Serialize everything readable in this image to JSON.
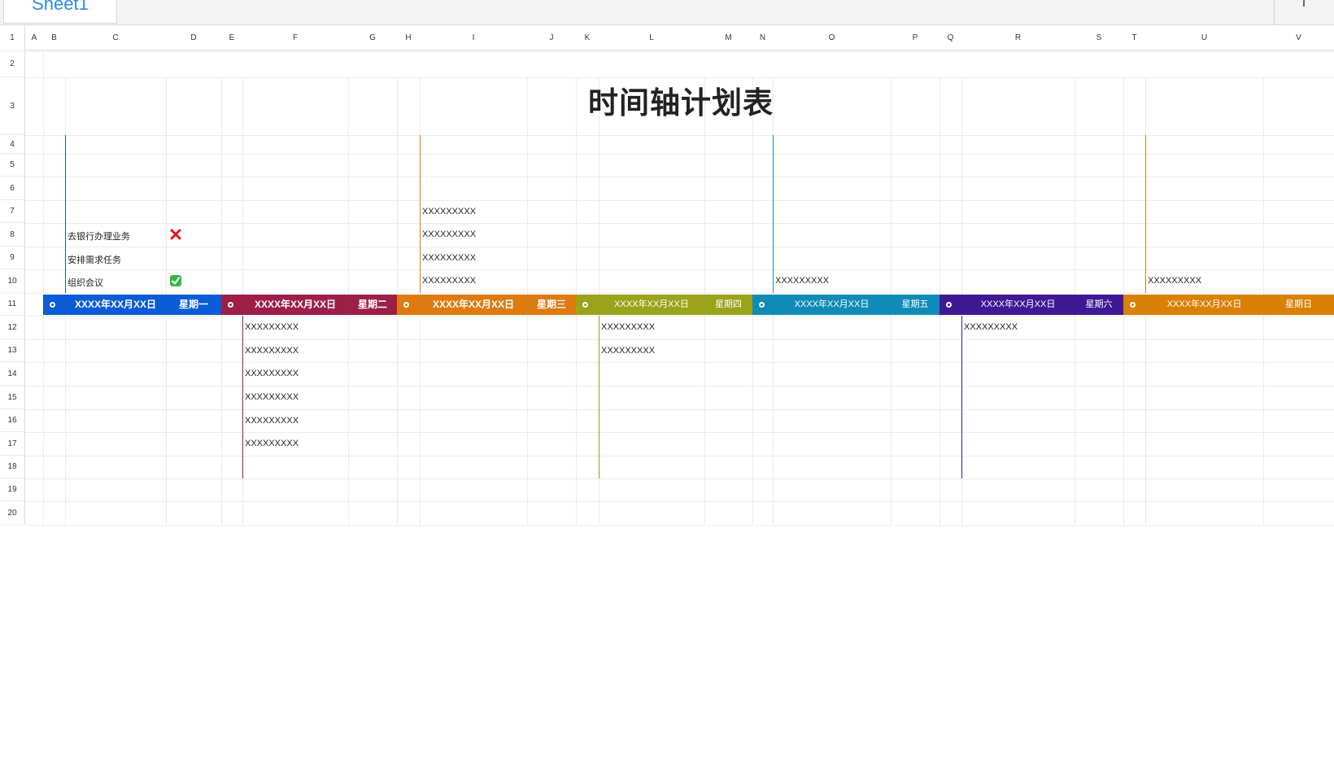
{
  "tab": {
    "sheet_name": "Sheet1"
  },
  "columns": [
    "A",
    "B",
    "C",
    "D",
    "E",
    "F",
    "G",
    "H",
    "I",
    "J",
    "K",
    "L",
    "M",
    "N",
    "O",
    "P",
    "Q",
    "R",
    "S",
    "T",
    "U",
    "V"
  ],
  "rows": [
    "1",
    "2",
    "3",
    "4",
    "5",
    "6",
    "7",
    "8",
    "9",
    "10",
    "11",
    "12",
    "13",
    "14",
    "15",
    "16",
    "17",
    "18",
    "19",
    "20"
  ],
  "title": "时间轴计划表",
  "tasks": [
    {
      "label": "去银行办理业务",
      "status": "x-icon"
    },
    {
      "label": "安排需求任务",
      "status": ""
    },
    {
      "label": "组织会议",
      "status": "check-icon"
    }
  ],
  "days": [
    {
      "date": "XXXX年XX月XX日",
      "weekday": "星期一",
      "color": "#0a5bd6",
      "items_above": [],
      "items_below": []
    },
    {
      "date": "XXXX年XX月XX日",
      "weekday": "星期二",
      "color": "#9c1f47",
      "items_above": [],
      "items_below": [
        "XXXXXXXXX",
        "XXXXXXXXX",
        "XXXXXXXXX",
        "XXXXXXXXX",
        "XXXXXXXXX",
        "XXXXXXXXX"
      ]
    },
    {
      "date": "XXXX年XX月XX日",
      "weekday": "星期三",
      "color": "#dd7a10",
      "items_above": [
        "XXXXXXXXX",
        "XXXXXXXXX",
        "XXXXXXXXX",
        "XXXXXXXXX"
      ],
      "items_below": []
    },
    {
      "date": "XXXX年XX月XX日",
      "weekday": "星期四",
      "color": "#9aa31a",
      "items_above": [],
      "items_below": [
        "XXXXXXXXX",
        "XXXXXXXXX"
      ]
    },
    {
      "date": "XXXX年XX月XX日",
      "weekday": "星期五",
      "color": "#108bb8",
      "items_above": [
        "XXXXXXXXX"
      ],
      "items_below": []
    },
    {
      "date": "XXXX年XX月XX日",
      "weekday": "星期六",
      "color": "#3d1a93",
      "items_above": [],
      "items_below": [
        "XXXXXXXXX"
      ]
    },
    {
      "date": "XXXX年XX月XX日",
      "weekday": "星期日",
      "color": "#d98007",
      "items_above": [
        "XXXXXXXXX"
      ],
      "items_below": []
    }
  ]
}
